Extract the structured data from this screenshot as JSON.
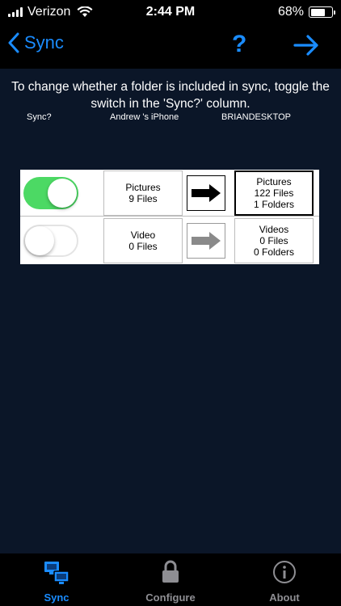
{
  "status_bar": {
    "carrier": "Verizon",
    "time": "2:44 PM",
    "battery_percent": "68%",
    "battery_level": 0.68
  },
  "nav": {
    "back_label": "Sync",
    "help_label": "?"
  },
  "instructions": "To change whether a folder is included in sync, toggle the switch in the 'Sync?' column.",
  "columns": {
    "sync": "Sync?",
    "phone": "Andrew 's iPhone",
    "desktop": "BRIANDESKTOP"
  },
  "rows": [
    {
      "sync_on": true,
      "phone_folder": "Pictures",
      "phone_files": "9 Files",
      "desktop_folder": "Pictures",
      "desktop_files": "122 Files",
      "desktop_folders": "1 Folders"
    },
    {
      "sync_on": false,
      "phone_folder": "Video",
      "phone_files": "0 Files",
      "desktop_folder": "Videos",
      "desktop_files": "0 Files",
      "desktop_folders": "0 Folders"
    }
  ],
  "tabs": [
    {
      "label": "Sync",
      "icon": "computers-icon",
      "active": true
    },
    {
      "label": "Configure",
      "icon": "lock-icon",
      "active": false
    },
    {
      "label": "About",
      "icon": "info-icon",
      "active": false
    }
  ],
  "colors": {
    "background": "#0b1628",
    "accent": "#1a8cff",
    "toggle_on": "#4cd964"
  }
}
